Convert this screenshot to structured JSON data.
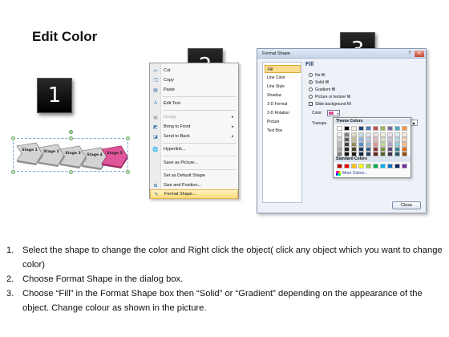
{
  "title": "Edit Color",
  "badges": [
    "1",
    "2",
    "3"
  ],
  "stages": [
    "Stage 1",
    "Stage 2",
    "Stage 3",
    "Stage 4",
    "Stage 5"
  ],
  "colors": {
    "gray_shape": "#d0d0d0",
    "pink_shape": "#e0559a",
    "highlight": "#ffd978",
    "badge": "#000000"
  },
  "context_menu": {
    "items": [
      {
        "label": "Cut",
        "icon": "scissors-icon",
        "disabled": false,
        "submenu": false
      },
      {
        "label": "Copy",
        "icon": "copy-icon",
        "disabled": false,
        "submenu": false
      },
      {
        "label": "Paste",
        "icon": "paste-icon",
        "disabled": false,
        "submenu": false
      },
      {
        "label": "Edit Text",
        "icon": "edit-text-icon",
        "disabled": false,
        "submenu": false
      },
      {
        "label": "Group",
        "icon": "group-icon",
        "disabled": true,
        "submenu": true
      },
      {
        "label": "Bring to Front",
        "icon": "bring-front-icon",
        "disabled": false,
        "submenu": true
      },
      {
        "label": "Send to Back",
        "icon": "send-back-icon",
        "disabled": false,
        "submenu": true
      },
      {
        "label": "Hyperlink...",
        "icon": "hyperlink-icon",
        "disabled": false,
        "submenu": false
      },
      {
        "label": "Save as Picture...",
        "icon": "",
        "disabled": false,
        "submenu": false
      },
      {
        "label": "Set as Default Shape",
        "icon": "",
        "disabled": false,
        "submenu": false
      },
      {
        "label": "Size and Position...",
        "icon": "size-position-icon",
        "disabled": false,
        "submenu": false
      },
      {
        "label": "Format Shape...",
        "icon": "format-shape-icon",
        "disabled": false,
        "submenu": false,
        "highlighted": true
      }
    ]
  },
  "format_dialog": {
    "title": "Format Shape",
    "nav": [
      "Fill",
      "Line Color",
      "Line Style",
      "Shadow",
      "3-D Format",
      "3-D Rotation",
      "Picture",
      "Text Box"
    ],
    "active_nav": "Fill",
    "section_title": "Fill",
    "fill_options": [
      {
        "label": "No fill",
        "checked": false
      },
      {
        "label": "Solid fill",
        "checked": true
      },
      {
        "label": "Gradient fill",
        "checked": false
      },
      {
        "label": "Picture or texture fill",
        "checked": false
      },
      {
        "label": "Slide background fill",
        "checked": false
      }
    ],
    "color_label": "Color:",
    "transparency_label": "Transpa",
    "close_label": "Close"
  },
  "color_picker": {
    "theme_title": "Theme Colors",
    "standard_title": "Standard Colors",
    "more_colors": "More Colors...",
    "theme_top": [
      "#ffffff",
      "#000000",
      "#eeece1",
      "#1f497d",
      "#4f81bd",
      "#c0504d",
      "#9bbb59",
      "#8064a2",
      "#4bacc6",
      "#f79646"
    ],
    "theme_columns": [
      [
        "#f2f2f2",
        "#d9d9d9",
        "#bfbfbf",
        "#a6a6a6",
        "#808080"
      ],
      [
        "#7f7f7f",
        "#595959",
        "#404040",
        "#262626",
        "#0d0d0d"
      ],
      [
        "#ddd9c3",
        "#c4bd97",
        "#938953",
        "#494429",
        "#1d1b10"
      ],
      [
        "#c6d9f0",
        "#8db3e2",
        "#548dd4",
        "#17365d",
        "#0f243e"
      ],
      [
        "#dbe5f1",
        "#b8cce4",
        "#95b3d7",
        "#366092",
        "#244061"
      ],
      [
        "#f2dcdb",
        "#e5b9b7",
        "#d99694",
        "#953734",
        "#632423"
      ],
      [
        "#ebf1dd",
        "#d7e3bc",
        "#c3d69b",
        "#76923c",
        "#4f6128"
      ],
      [
        "#e5e0ec",
        "#ccc1d9",
        "#b2a2c7",
        "#5f497a",
        "#3f3151"
      ],
      [
        "#dbeef3",
        "#b7dde8",
        "#92cddc",
        "#31859b",
        "#205867"
      ],
      [
        "#fdeada",
        "#fbd5b5",
        "#fac08f",
        "#e36c09",
        "#974806"
      ]
    ],
    "standard": [
      "#c00000",
      "#ff0000",
      "#ffc000",
      "#ffff00",
      "#92d050",
      "#00b050",
      "#00b0f0",
      "#0070c0",
      "#002060",
      "#7030a0"
    ]
  },
  "steps": [
    {
      "num": "1.",
      "text": "Select the shape to change the color and Right click the object( click any object which you want to change color)"
    },
    {
      "num": "2.",
      "text": "Choose Format Shape in the dialog box."
    },
    {
      "num": "3.",
      "text": "Choose “Fill” in the Format Shape box then “Solid” or “Gradient” depending on the appearance of the object. Change colour as shown in the picture."
    }
  ]
}
